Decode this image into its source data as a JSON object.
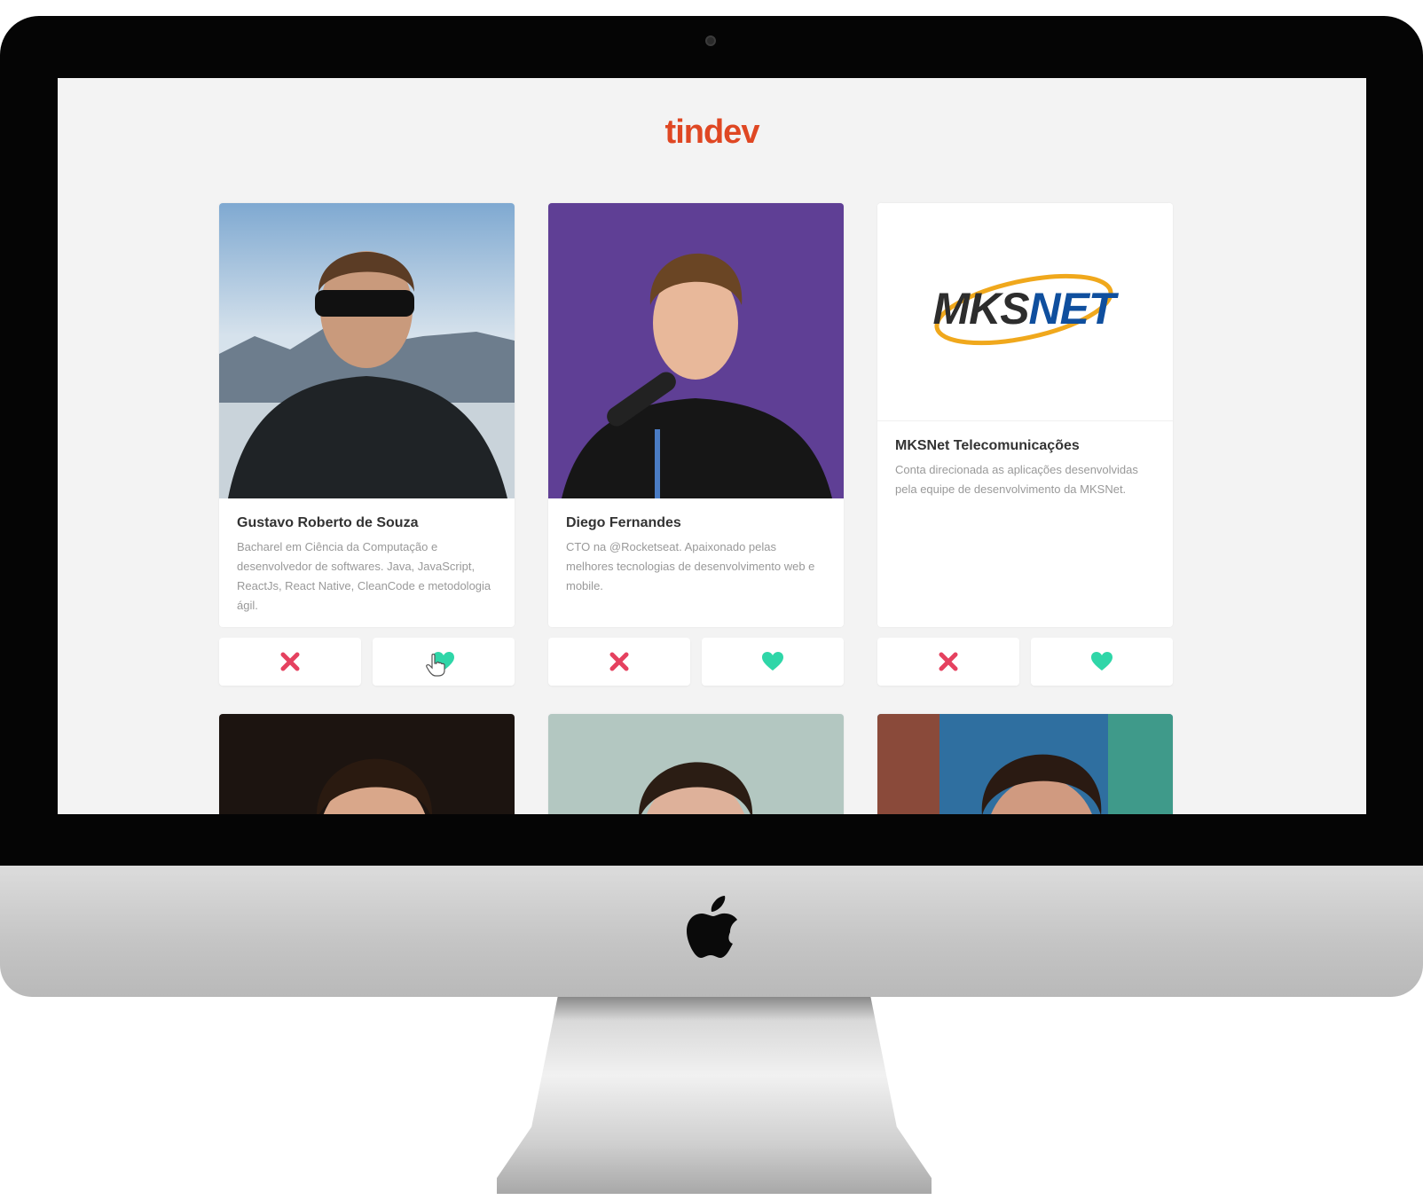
{
  "app": {
    "logo": "tindev"
  },
  "colors": {
    "brand": "#df4723",
    "dislike": "#e5415f",
    "like": "#2fd6a8",
    "name": "#333333",
    "bio": "#999999"
  },
  "icons": {
    "dislike": "close-x-icon",
    "like": "heart-icon",
    "cursor": "hand-pointer-icon",
    "hardware": "apple-logo-icon"
  },
  "developers": [
    {
      "name": "Gustavo Roberto de Souza",
      "bio": "Bacharel em Ciência da Computação e desenvolvedor de softwares. Java, JavaScript, ReactJs, React Native, CleanCode e metodologia ágil."
    },
    {
      "name": "Diego Fernandes",
      "bio": "CTO na @Rocketseat. Apaixonado pelas melhores tecnologias de desenvolvimento web e mobile."
    },
    {
      "name": "MKSNet Telecomunicações",
      "bio": "Conta direcionada as aplicações desenvolvidas pela equipe de desenvolvimento da MKSNet.",
      "logo_text_a": "MKS",
      "logo_text_b": "NET"
    }
  ]
}
